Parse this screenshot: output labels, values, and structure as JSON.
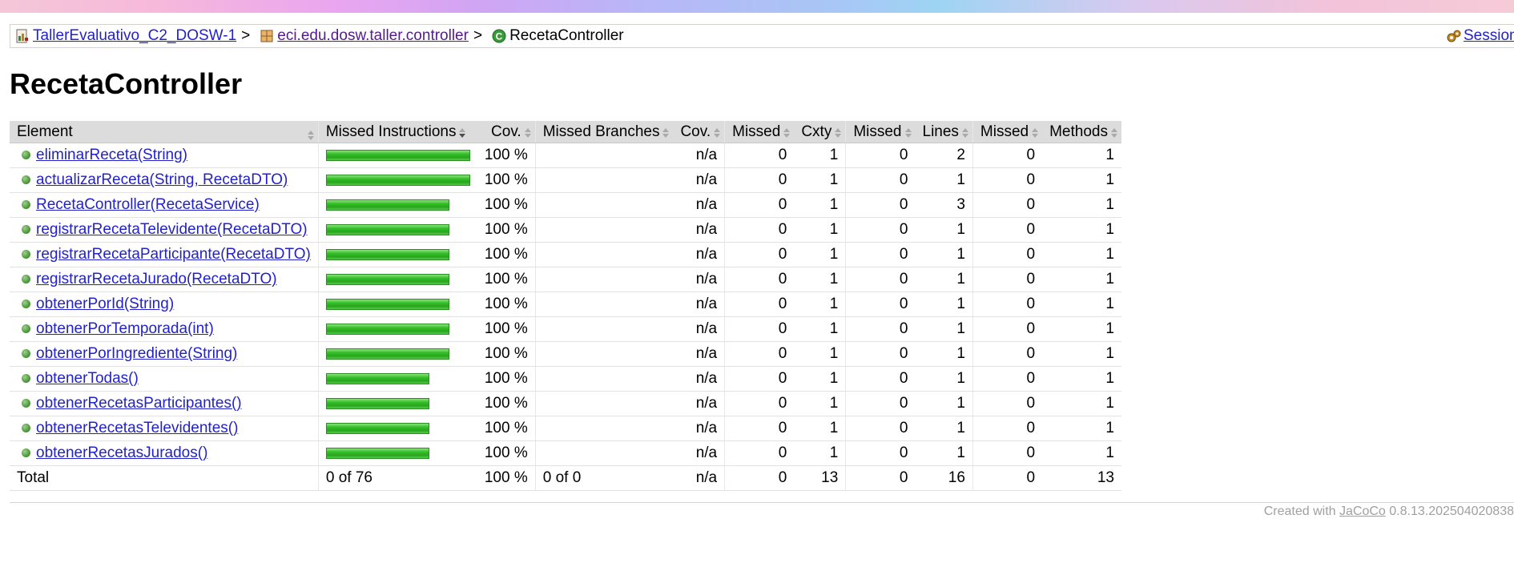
{
  "breadcrumb": {
    "project": "TallerEvaluativo_C2_DOSW-1",
    "package": "eci.edu.dosw.taller.controller",
    "class": "RecetaController",
    "separator": ">",
    "session": "Session"
  },
  "page_title": "RecetaController",
  "columns": [
    "Element",
    "Missed Instructions",
    "Cov.",
    "Missed Branches",
    "Cov.",
    "Missed",
    "Cxty",
    "Missed",
    "Lines",
    "Missed",
    "Methods"
  ],
  "rows": [
    {
      "element": "eliminarReceta(String)",
      "bar_fraction": 1.0,
      "cov": "100 %",
      "branch_cov": "n/a",
      "missed_cxty": "0",
      "cxty": "1",
      "missed_lines": "0",
      "lines": "2",
      "missed_methods": "0",
      "methods": "1"
    },
    {
      "element": "actualizarReceta(String, RecetaDTO)",
      "bar_fraction": 1.0,
      "cov": "100 %",
      "branch_cov": "n/a",
      "missed_cxty": "0",
      "cxty": "1",
      "missed_lines": "0",
      "lines": "1",
      "missed_methods": "0",
      "methods": "1"
    },
    {
      "element": "RecetaController(RecetaService)",
      "bar_fraction": 0.857,
      "cov": "100 %",
      "branch_cov": "n/a",
      "missed_cxty": "0",
      "cxty": "1",
      "missed_lines": "0",
      "lines": "3",
      "missed_methods": "0",
      "methods": "1"
    },
    {
      "element": "registrarRecetaTelevidente(RecetaDTO)",
      "bar_fraction": 0.857,
      "cov": "100 %",
      "branch_cov": "n/a",
      "missed_cxty": "0",
      "cxty": "1",
      "missed_lines": "0",
      "lines": "1",
      "missed_methods": "0",
      "methods": "1"
    },
    {
      "element": "registrarRecetaParticipante(RecetaDTO)",
      "bar_fraction": 0.857,
      "cov": "100 %",
      "branch_cov": "n/a",
      "missed_cxty": "0",
      "cxty": "1",
      "missed_lines": "0",
      "lines": "1",
      "missed_methods": "0",
      "methods": "1"
    },
    {
      "element": "registrarRecetaJurado(RecetaDTO)",
      "bar_fraction": 0.857,
      "cov": "100 %",
      "branch_cov": "n/a",
      "missed_cxty": "0",
      "cxty": "1",
      "missed_lines": "0",
      "lines": "1",
      "missed_methods": "0",
      "methods": "1"
    },
    {
      "element": "obtenerPorId(String)",
      "bar_fraction": 0.857,
      "cov": "100 %",
      "branch_cov": "n/a",
      "missed_cxty": "0",
      "cxty": "1",
      "missed_lines": "0",
      "lines": "1",
      "missed_methods": "0",
      "methods": "1"
    },
    {
      "element": "obtenerPorTemporada(int)",
      "bar_fraction": 0.857,
      "cov": "100 %",
      "branch_cov": "n/a",
      "missed_cxty": "0",
      "cxty": "1",
      "missed_lines": "0",
      "lines": "1",
      "missed_methods": "0",
      "methods": "1"
    },
    {
      "element": "obtenerPorIngrediente(String)",
      "bar_fraction": 0.857,
      "cov": "100 %",
      "branch_cov": "n/a",
      "missed_cxty": "0",
      "cxty": "1",
      "missed_lines": "0",
      "lines": "1",
      "missed_methods": "0",
      "methods": "1"
    },
    {
      "element": "obtenerTodas()",
      "bar_fraction": 0.714,
      "cov": "100 %",
      "branch_cov": "n/a",
      "missed_cxty": "0",
      "cxty": "1",
      "missed_lines": "0",
      "lines": "1",
      "missed_methods": "0",
      "methods": "1"
    },
    {
      "element": "obtenerRecetasParticipantes()",
      "bar_fraction": 0.714,
      "cov": "100 %",
      "branch_cov": "n/a",
      "missed_cxty": "0",
      "cxty": "1",
      "missed_lines": "0",
      "lines": "1",
      "missed_methods": "0",
      "methods": "1"
    },
    {
      "element": "obtenerRecetasTelevidentes()",
      "bar_fraction": 0.714,
      "cov": "100 %",
      "branch_cov": "n/a",
      "missed_cxty": "0",
      "cxty": "1",
      "missed_lines": "0",
      "lines": "1",
      "missed_methods": "0",
      "methods": "1"
    },
    {
      "element": "obtenerRecetasJurados()",
      "bar_fraction": 0.714,
      "cov": "100 %",
      "branch_cov": "n/a",
      "missed_cxty": "0",
      "cxty": "1",
      "missed_lines": "0",
      "lines": "1",
      "missed_methods": "0",
      "methods": "1"
    }
  ],
  "total": {
    "label": "Total",
    "missed_instructions": "0 of 76",
    "cov": "100 %",
    "missed_branches": "0 of 0",
    "branch_cov": "n/a",
    "missed_cxty": "0",
    "cxty": "13",
    "missed_lines": "0",
    "lines": "16",
    "missed_methods": "0",
    "methods": "13"
  },
  "footer": {
    "prefix": "Created with",
    "link": "JaCoCo",
    "version": "0.8.13.202504020838"
  },
  "colors": {
    "bar_green": "#35c02b",
    "header_bg": "#dcdcdc",
    "link": "#2222cc",
    "visited_link": "#551a8b"
  },
  "icons": {
    "project": "report-icon",
    "package": "package-icon",
    "class": "class-icon",
    "session": "session-icon",
    "method": "method-dot-icon",
    "sort": "sort-arrows-icon"
  }
}
